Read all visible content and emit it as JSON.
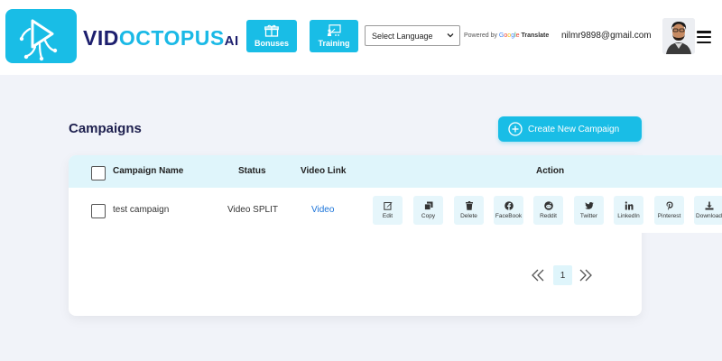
{
  "header": {
    "logo": {
      "part1": "VID",
      "part2": "OCTOPUS",
      "part3": "AI"
    },
    "nav": {
      "bonuses_label": "Bonuses",
      "training_label": "Training"
    },
    "language_select": {
      "value": "Select Language"
    },
    "powered_by": {
      "prefix": "Powered by",
      "google": [
        "G",
        "o",
        "o",
        "g",
        "l",
        "e"
      ],
      "translate": "Translate"
    },
    "user_email": "nilmr9898@gmail.com"
  },
  "main": {
    "title": "Campaigns",
    "create_button_label": "Create New Campaign",
    "table": {
      "headers": {
        "name": "Campaign Name",
        "status": "Status",
        "video_link": "Video Link",
        "action": "Action"
      },
      "rows": [
        {
          "name": "test campaign",
          "status": "Video SPLIT",
          "video_link": "Video"
        }
      ],
      "actions": [
        {
          "label": "Edit",
          "icon": "edit-icon"
        },
        {
          "label": "Copy",
          "icon": "copy-icon"
        },
        {
          "label": "Delete",
          "icon": "trash-icon"
        },
        {
          "label": "FaceBook",
          "icon": "facebook-icon"
        },
        {
          "label": "Reddit",
          "icon": "reddit-icon"
        },
        {
          "label": "Twitter",
          "icon": "twitter-icon"
        },
        {
          "label": "LinkedIn",
          "icon": "linkedin-icon"
        },
        {
          "label": "Pinterest",
          "icon": "pinterest-icon"
        },
        {
          "label": "Download",
          "icon": "download-icon"
        }
      ]
    },
    "pagination": {
      "current_page": "1"
    }
  },
  "colors": {
    "accent": "#19bde6",
    "brand_dark": "#1d1f6e",
    "link": "#1a73d9",
    "header_row_bg": "#dff5fb",
    "page_bg": "#f1f3f9"
  }
}
